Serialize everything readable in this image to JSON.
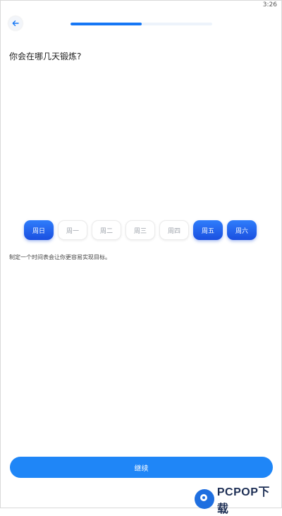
{
  "status_bar": {
    "time": "3:26"
  },
  "header": {
    "back_icon": "arrow-left-icon",
    "progress": {
      "fraction": 0.5
    }
  },
  "question": "你会在哪几天锻炼?",
  "days": [
    {
      "label": "周日",
      "selected": true
    },
    {
      "label": "周一",
      "selected": false
    },
    {
      "label": "周二",
      "selected": false
    },
    {
      "label": "周三",
      "selected": false
    },
    {
      "label": "周四",
      "selected": false
    },
    {
      "label": "周五",
      "selected": true
    },
    {
      "label": "周六",
      "selected": true
    }
  ],
  "hint": "制定一个时间表会让你更容易实现目标。",
  "continue_label": "继续",
  "watermark": {
    "text": "PCPOP下载"
  },
  "colors": {
    "accent": "#1677f5",
    "button": "#1f86f7",
    "selected_day": "#1a4fe0",
    "track": "#edf3fb"
  }
}
